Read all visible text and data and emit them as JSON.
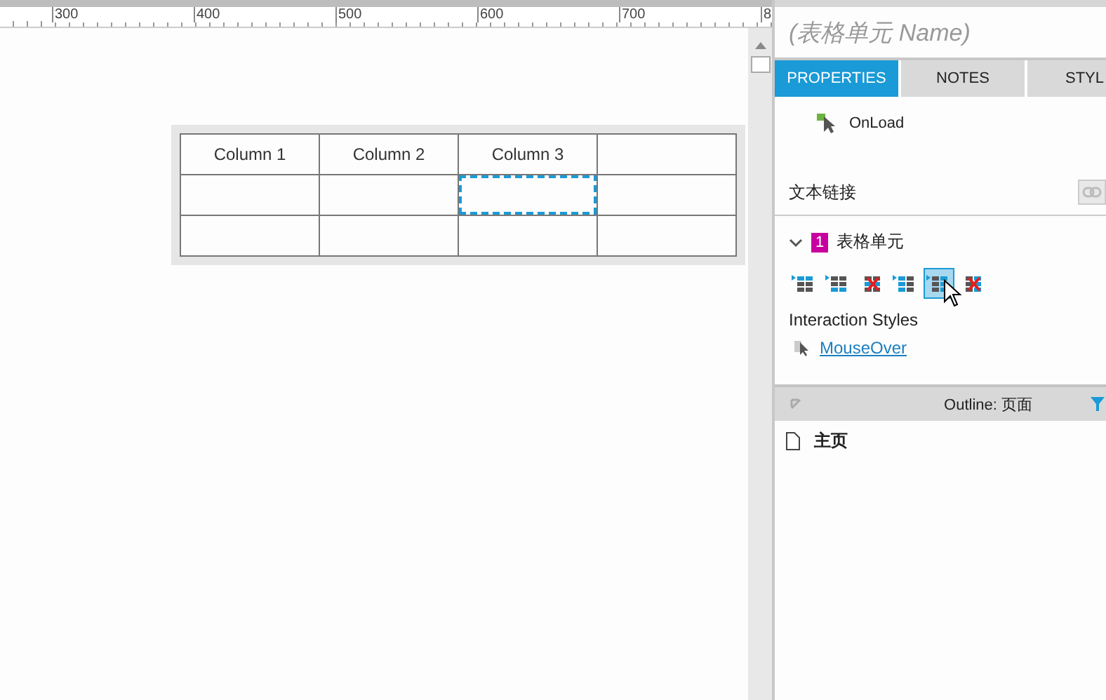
{
  "ruler": {
    "labels": [
      "300",
      "400",
      "500",
      "600",
      "700",
      "8"
    ]
  },
  "canvas": {
    "table": {
      "header": [
        "Column 1",
        "Column 2",
        "Column 3"
      ],
      "rows": [
        {
          "cells": [
            {
              "selected": false
            },
            {
              "selected": false
            },
            {
              "selected": true
            },
            {
              "selected": false
            }
          ]
        },
        {
          "cells": [
            {
              "selected": false
            },
            {
              "selected": false
            },
            {
              "selected": false
            },
            {
              "selected": false
            }
          ]
        }
      ]
    }
  },
  "panel": {
    "title": "(表格单元 Name)",
    "tabs": [
      {
        "label": "PROPERTIES",
        "selected": true
      },
      {
        "label": "NOTES",
        "selected": false
      },
      {
        "label": "STYL",
        "selected": false
      }
    ],
    "events": [
      {
        "name": "OnLoad"
      }
    ],
    "text_link": {
      "label": "文本链接"
    },
    "widget": {
      "badge": "1",
      "name": "表格单元",
      "expanded": true
    },
    "table_tools": [
      {
        "kind": "insert-row-above",
        "selected": false
      },
      {
        "kind": "insert-row-below",
        "selected": false
      },
      {
        "kind": "delete-row",
        "selected": false
      },
      {
        "kind": "insert-column-left",
        "selected": false
      },
      {
        "kind": "insert-column-right",
        "selected": true
      },
      {
        "kind": "delete-column",
        "selected": false
      }
    ],
    "interaction_styles": {
      "heading": "Interaction Styles",
      "items": [
        "MouseOver"
      ]
    },
    "outline": {
      "title": "Outline: 页面",
      "pages": [
        {
          "name": "主页"
        }
      ]
    }
  }
}
